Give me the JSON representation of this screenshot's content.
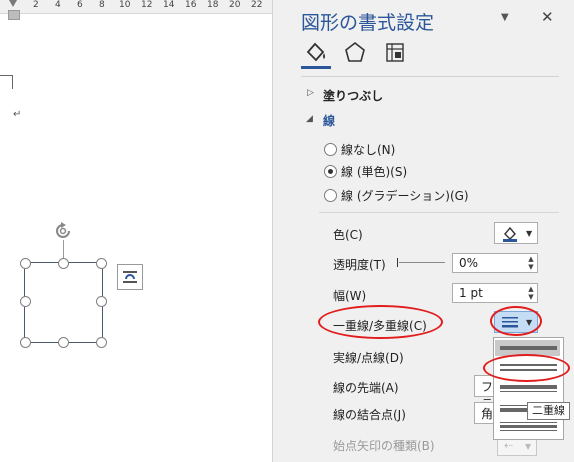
{
  "ruler": {
    "ticks": [
      "2",
      "4",
      "6",
      "8",
      "10",
      "12",
      "14",
      "16",
      "18",
      "20",
      "22"
    ]
  },
  "document": {
    "paragraph_mark": "↵"
  },
  "pane": {
    "title": "図形の書式設定",
    "dropdown_icon": "chevron-down-icon",
    "close_icon": "close-icon",
    "tabs": [
      {
        "icon": "paint-bucket-icon"
      },
      {
        "icon": "pentagon-icon"
      },
      {
        "icon": "size-layout-icon"
      }
    ],
    "fill_section": "塗りつぶし",
    "line_section": "線",
    "radio_none": "線なし(N)",
    "radio_solid": "線 (単色)(S)",
    "radio_gradient": "線 (グラデーション)(G)",
    "color_label": "色(C)",
    "transparency_label": "透明度(T)",
    "transparency_value": "0%",
    "width_label": "幅(W)",
    "width_value": "1 pt",
    "compound_label": "一重線/多重線(C)",
    "dash_label": "実線/点線(D)",
    "cap_label": "線の先端(A)",
    "cap_value": "フラ",
    "join_label": "線の結合点(J)",
    "join_value": "角",
    "arrow_label": "始点矢印の種類(B)",
    "tooltip": "二重線",
    "accent": "#2b579a",
    "highlight_color": "#e21d1d"
  }
}
